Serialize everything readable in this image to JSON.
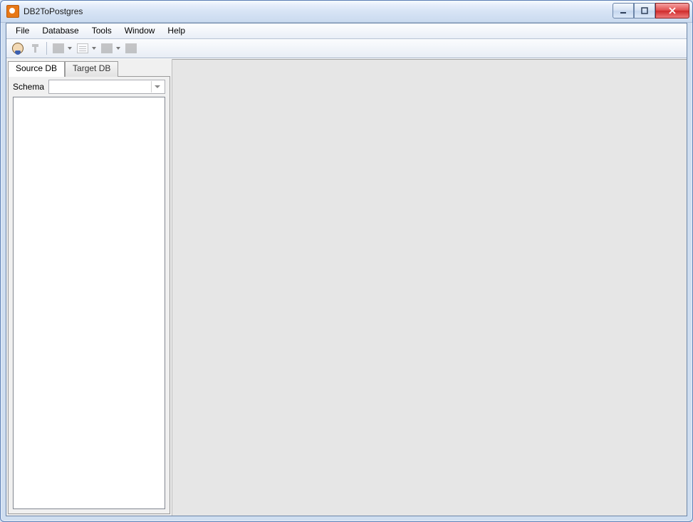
{
  "title": "DB2ToPostgres",
  "menu": {
    "file": "File",
    "database": "Database",
    "tools": "Tools",
    "window": "Window",
    "help": "Help"
  },
  "tabs": {
    "source": "Source DB",
    "target": "Target DB"
  },
  "sidebar": {
    "schema_label": "Schema",
    "schema_value": ""
  }
}
